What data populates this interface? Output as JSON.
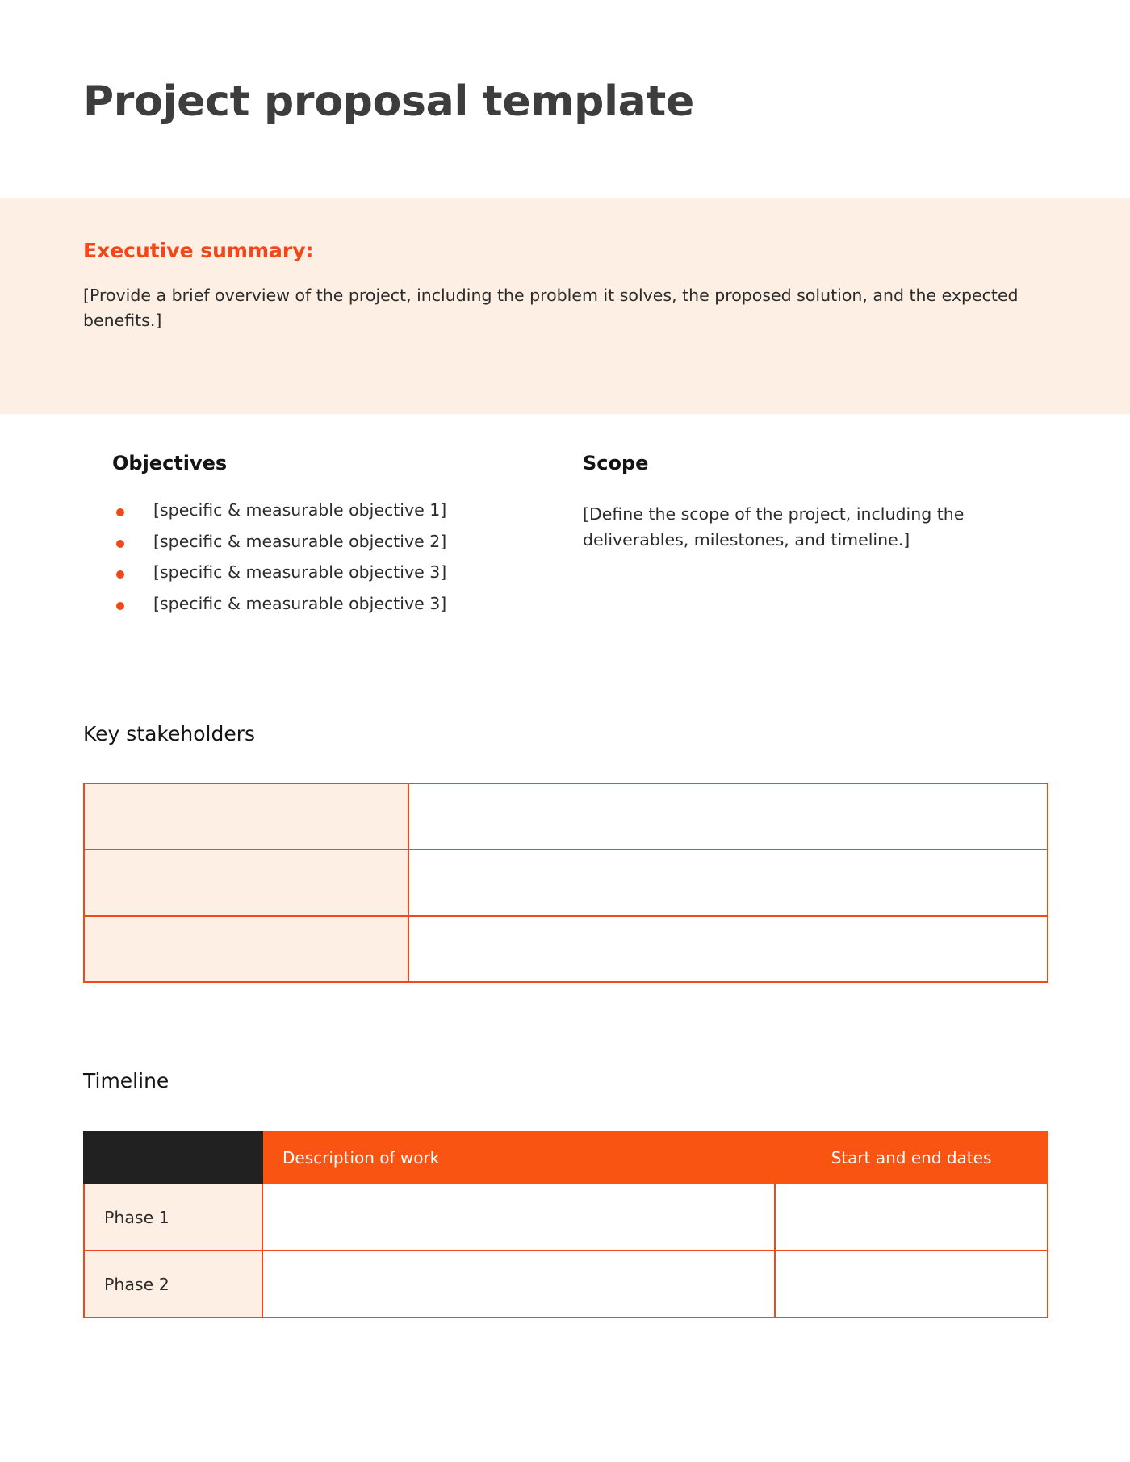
{
  "document": {
    "title": "Project proposal template"
  },
  "executive_summary": {
    "heading": "Executive summary:",
    "body": "[Provide a brief overview of the project, including the problem it solves, the proposed solution, and the expected benefits.]"
  },
  "objectives": {
    "heading": "Objectives",
    "items": [
      "[specific & measurable objective  1]",
      "[specific & measurable objective  2]",
      "[specific & measurable objective  3]",
      "[specific & measurable objective  3]"
    ]
  },
  "scope": {
    "heading": "Scope",
    "body": "[Define the scope of the project, including the deliverables, milestones, and timeline.]"
  },
  "key_stakeholders": {
    "heading": "Key stakeholders",
    "rows": [
      {
        "label": "",
        "value": ""
      },
      {
        "label": "",
        "value": ""
      },
      {
        "label": "",
        "value": ""
      }
    ]
  },
  "timeline": {
    "heading": "Timeline",
    "columns": [
      "",
      "Description of work",
      "Start and end dates"
    ],
    "rows": [
      {
        "phase": "Phase 1",
        "description": "",
        "dates": ""
      },
      {
        "phase": "Phase 2",
        "description": "",
        "dates": ""
      }
    ]
  },
  "theme": {
    "accent_orange": "#fa5412",
    "border_orange": "#f0481b",
    "peach_background": "#fdefe3",
    "dark_cell": "#212121",
    "title_gray": "#3d3d3d"
  }
}
